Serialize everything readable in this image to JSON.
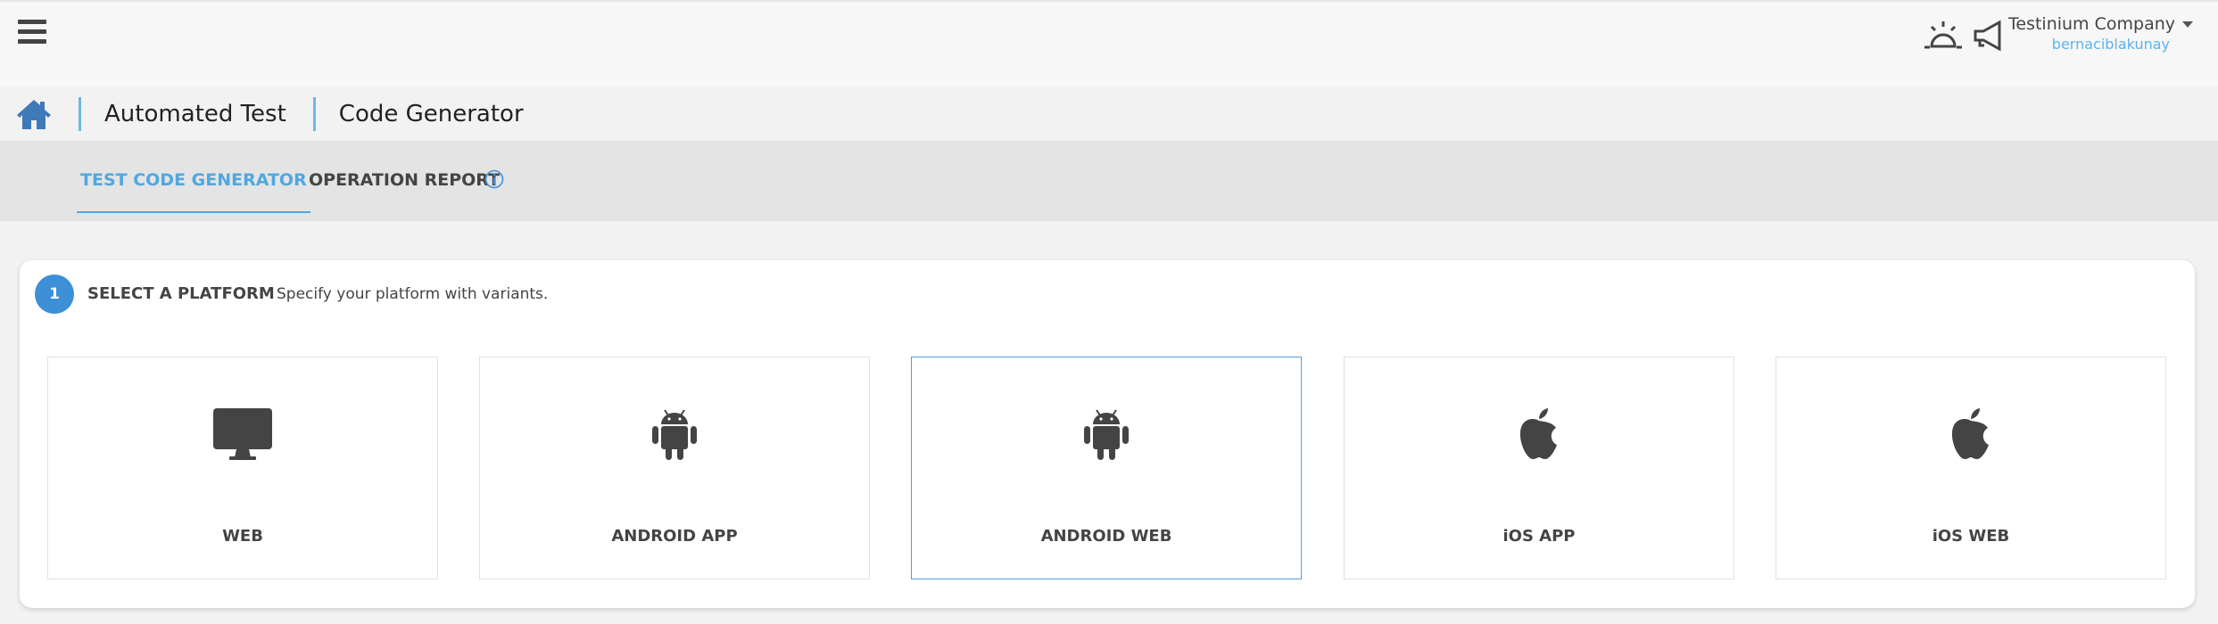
{
  "header": {
    "company": "Testinium Company",
    "username": "bernaciblakunay"
  },
  "breadcrumb": [
    "Automated Test",
    "Code Generator"
  ],
  "tabs": [
    {
      "label": "TEST CODE GENERATOR",
      "active": true
    },
    {
      "label": "OPERATION REPORT",
      "active": false
    }
  ],
  "step": {
    "number": "1",
    "title": "SELECT A PLATFORM",
    "description": "Specify your platform with variants."
  },
  "platforms": [
    {
      "label": "WEB",
      "icon": "monitor-icon",
      "selected": false
    },
    {
      "label": "ANDROID APP",
      "icon": "android-icon",
      "selected": false
    },
    {
      "label": "ANDROID WEB",
      "icon": "android-icon",
      "selected": true
    },
    {
      "label": "iOS APP",
      "icon": "apple-icon",
      "selected": false
    },
    {
      "label": "iOS WEB",
      "icon": "apple-icon",
      "selected": false
    }
  ],
  "colors": {
    "accent": "#4fa8e0",
    "step": "#3d8fd6",
    "home": "#3f79b8"
  }
}
